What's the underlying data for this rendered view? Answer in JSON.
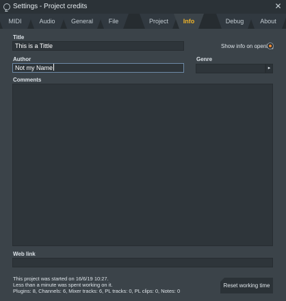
{
  "window": {
    "title": "Settings - Project credits",
    "close_glyph": "✕"
  },
  "tabs": [
    {
      "label": "MIDI",
      "active": false
    },
    {
      "label": "Audio",
      "active": false
    },
    {
      "label": "General",
      "active": false
    },
    {
      "label": "File",
      "active": false
    },
    {
      "label": "Project",
      "active": false
    },
    {
      "label": "Info",
      "active": true
    },
    {
      "label": "Debug",
      "active": false
    },
    {
      "label": "About",
      "active": false
    }
  ],
  "form": {
    "title_label": "Title",
    "title_value": "This is a Tittle",
    "show_info_label": "Show info on opening",
    "show_info_checked": true,
    "author_label": "Author",
    "author_value": "Not my Name",
    "genre_label": "Genre",
    "genre_value": "",
    "genre_arrow": "▸",
    "comments_label": "Comments",
    "comments_value": "",
    "weblink_label": "Web link",
    "weblink_value": ""
  },
  "footer": {
    "line1": "This project was started on 16/6/19 10:27.",
    "line2": "Less than a minute was spent working on it.",
    "line3": "Plugins: 8, Channels: 6, Mixer tracks: 6, PL tracks: 0, PL clips: 0, Notes: 0",
    "reset_label": "Reset working time"
  },
  "colors": {
    "accent_tab": "#f0b429",
    "radio_on": "#f28b30",
    "background": "#3b4349",
    "field_bg": "#2e353a"
  }
}
